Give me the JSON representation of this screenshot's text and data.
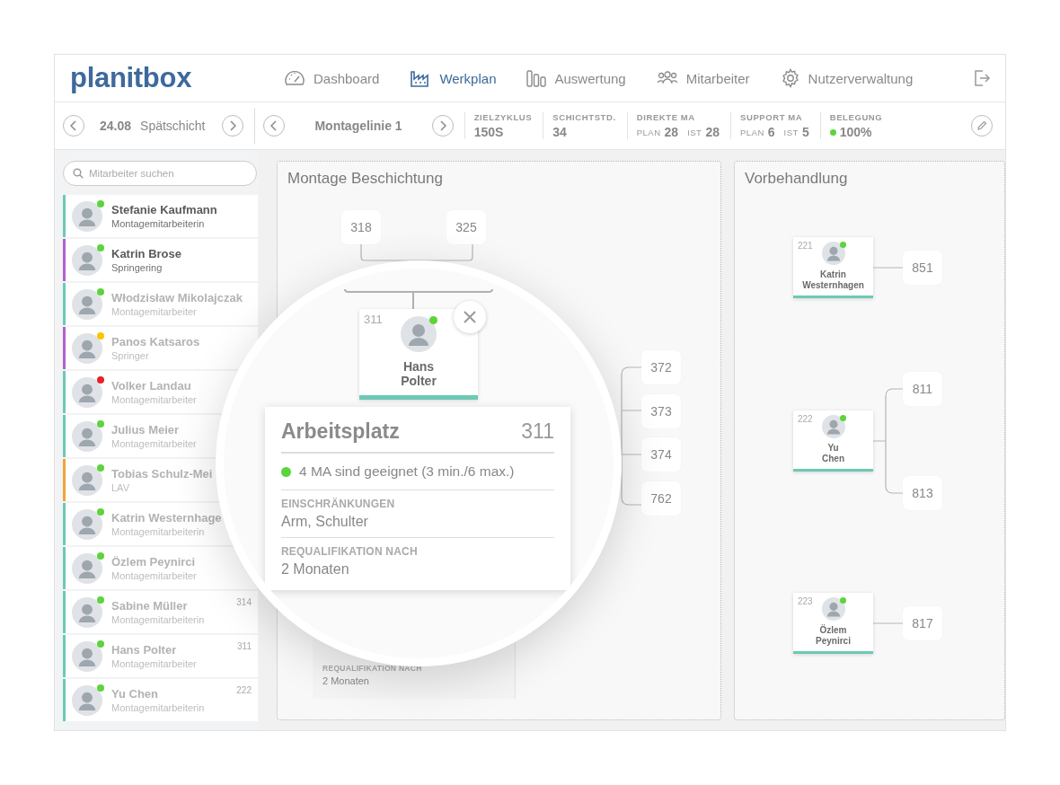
{
  "brand": "planitbox",
  "nav": [
    {
      "label": "Dashboard",
      "selected": false
    },
    {
      "label": "Werkplan",
      "selected": true
    },
    {
      "label": "Auswertung",
      "selected": false
    },
    {
      "label": "Mitarbeiter",
      "selected": false
    },
    {
      "label": "Nutzerverwaltung",
      "selected": false
    }
  ],
  "toolbar": {
    "date": "24.08",
    "shift": "Spätschicht",
    "line": "Montagelinie 1",
    "stats": [
      {
        "kind": "single",
        "label": "ZIELZYKLUS",
        "value": "150S"
      },
      {
        "kind": "single",
        "label": "SCHICHTSTD.",
        "value": "34"
      },
      {
        "kind": "planned",
        "label": "DIREKTE MA",
        "plan_label": "PLAN",
        "plan": "28",
        "actual_label": "IST",
        "actual": "28"
      },
      {
        "kind": "planned",
        "label": "SUPPORT MA",
        "plan_label": "PLAN",
        "plan": "6",
        "actual_label": "IST",
        "actual": "5"
      },
      {
        "kind": "status",
        "label": "BELEGUNG",
        "value": "100%",
        "color": "#5cd43c"
      }
    ]
  },
  "search": {
    "placeholder": "Mitarbeiter suchen"
  },
  "employees": [
    {
      "name": "Stefanie Kaufmann",
      "role": "Montagemitarbeiterin",
      "dimmed": false,
      "color": "#5cd43c",
      "group": {
        "color": "#6cc9b4"
      }
    },
    {
      "name": "Katrin Brose",
      "role": "Springering",
      "dimmed": false,
      "color": "#5cd43c",
      "group": {
        "color": "#b45fd0"
      }
    },
    {
      "name": "Włodzisław Mikolajczak",
      "role": "Montagemitarbeiter",
      "dimmed": true,
      "color": "#5cd43c",
      "group": {
        "color": "#6cc9b4"
      }
    },
    {
      "name": "Panos Katsaros",
      "role": "Springer",
      "dimmed": true,
      "color": "#f7c600",
      "group": {
        "color": "#b45fd0"
      }
    },
    {
      "name": "Volker Landau",
      "role": "Montagemitarbeiter",
      "dimmed": true,
      "color": "#e8202a",
      "group": {
        "color": "#6cc9b4"
      }
    },
    {
      "name": "Julius Meier",
      "role": "Montagemitarbeiter",
      "dimmed": true,
      "color": "#5cd43c",
      "group": {
        "color": "#6cc9b4"
      }
    },
    {
      "name": "Tobias Schulz-Mei",
      "role": "LAV",
      "dimmed": true,
      "color": "#5cd43c",
      "group": {
        "color": "#f0a43a"
      }
    },
    {
      "name": "Katrin Westernhage",
      "role": "Montagemitarbeiterin",
      "dimmed": true,
      "color": "#5cd43c",
      "group": {
        "color": "#6cc9b4"
      }
    },
    {
      "name": "Özlem Peynirci",
      "role": "Montagemitarbeiter",
      "dimmed": true,
      "color": "#5cd43c",
      "group": {
        "color": "#6cc9b4"
      }
    },
    {
      "name": "Sabine Müller",
      "role": "Montagemitarbeiterin",
      "station": "314",
      "dimmed": true,
      "color": "#5cd43c",
      "group": {
        "color": "#6cc9b4"
      }
    },
    {
      "name": "Hans Polter",
      "role": "Montagemitarbeiter",
      "station": "311",
      "dimmed": true,
      "color": "#5cd43c",
      "group": {
        "color": "#6cc9b4"
      }
    },
    {
      "name": "Yu Chen",
      "role": "Montagemitarbeiterin",
      "station": "222",
      "dimmed": true,
      "color": "#5cd43c",
      "group": {
        "color": "#6cc9b4"
      }
    }
  ],
  "areas": [
    {
      "title": "Montage Beschichtung",
      "top_stations": [
        "318",
        "325"
      ],
      "side_stations": [
        "372",
        "373",
        "374",
        "762"
      ],
      "hidden_info": {
        "label": "REQUALIFIKATION NACH",
        "value": "2 Monaten"
      }
    },
    {
      "title": "Vorbehandlung",
      "assignments": [
        {
          "workplace": "221",
          "first_name": "Katrin",
          "last_name": "Westernhagen",
          "color": "#5cd43c",
          "stations": [
            "851"
          ]
        },
        {
          "workplace": "222",
          "first_name": "Yu",
          "last_name": "Chen",
          "color": "#5cd43c",
          "stations": [
            "811",
            "813"
          ]
        },
        {
          "workplace": "223",
          "first_name": "Özlem",
          "last_name": "Peynirci",
          "color": "#5cd43c",
          "stations": [
            "817"
          ]
        }
      ]
    }
  ],
  "magnifier": {
    "card": {
      "workplace": "311",
      "first_name": "Hans",
      "last_name": "Polter",
      "color": "#5cd43c"
    },
    "info": {
      "title": "Arbeitsplatz",
      "number": "311",
      "suitability": "4 MA sind geeignet (3 min./6 max.)",
      "color": "#5cd43c",
      "sections": [
        {
          "label": "EINSCHRÄNKUNGEN",
          "value": "Arm, Schulter"
        },
        {
          "label": "REQUALIFIKATION NACH",
          "value": "2 Monaten"
        }
      ]
    }
  }
}
